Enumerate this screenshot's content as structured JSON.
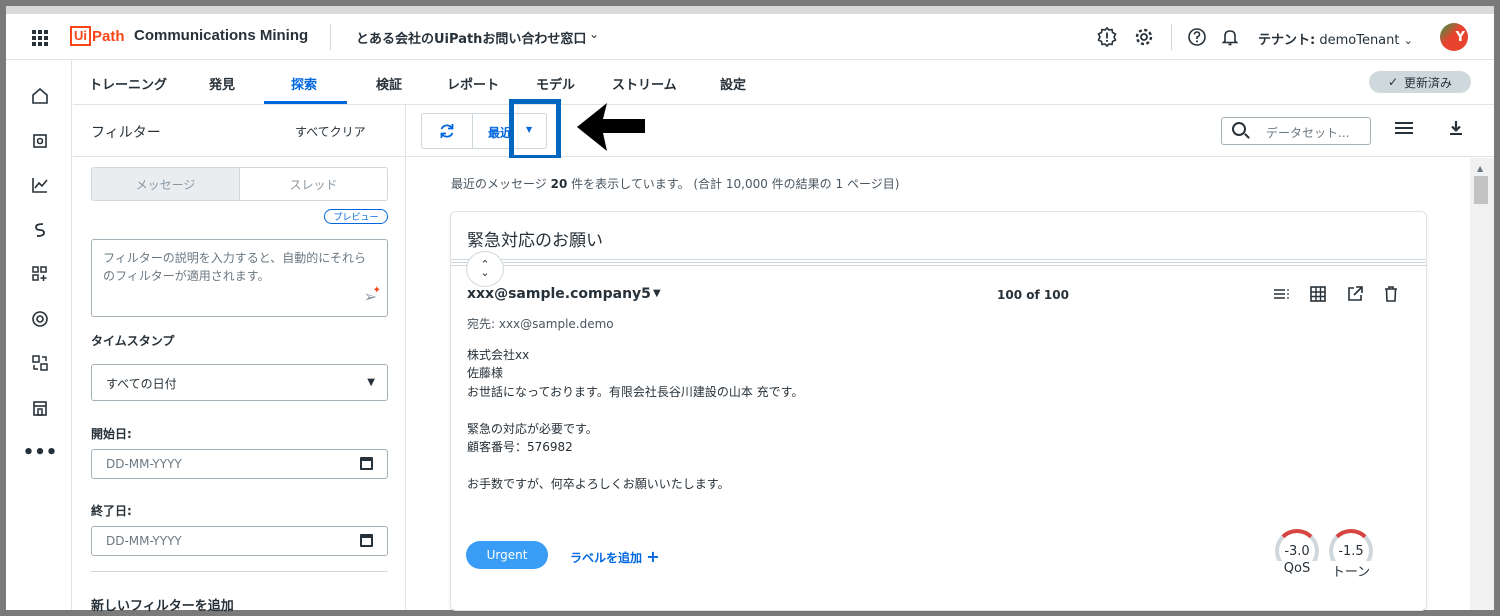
{
  "header": {
    "logo_ui": "Ui",
    "logo_path": "Path",
    "product": "Communications Mining",
    "project": "とある会社のUiPathお問い合わせ窓口",
    "project_caret": "⌄",
    "tenant_label": "テナント:",
    "tenant_value": "demoTenant",
    "tenant_caret": "⌄",
    "avatar_initial": "Y",
    "icons": [
      "apps-icon",
      "alert-icon",
      "gear-icon",
      "help-icon",
      "bell-icon"
    ]
  },
  "rail": {
    "icons": [
      "home-icon",
      "label-icon",
      "chart-icon",
      "flow-icon",
      "add-widget-icon",
      "stream-icon",
      "sync-icon",
      "store-icon",
      "more-icon"
    ]
  },
  "tabs": {
    "items": [
      "トレーニング",
      "発見",
      "探索",
      "検証",
      "レポート",
      "モデル",
      "ストリーム",
      "設定"
    ],
    "active": "探索",
    "status_badge": "更新済み"
  },
  "filter": {
    "title": "フィルター",
    "clear_all": "すべてクリア",
    "segments": [
      "メッセージ",
      "スレッド"
    ],
    "preview_pill": "プレビュー",
    "description_placeholder": "フィルターの説明を入力すると、自動的にそれらのフィルターが適用されます。",
    "timestamp_label": "タイムスタンプ",
    "timestamp_value": "すべての日付",
    "start_label": "開始日:",
    "start_placeholder": "DD-MM-YYYY",
    "end_label": "終了日:",
    "end_placeholder": "DD-MM-YYYY",
    "add_filter": "新しいフィルターを追加"
  },
  "toolbar": {
    "sort_label": "最近",
    "search_placeholder": "データセット..."
  },
  "content": {
    "summary_prefix": "最近のメッセージ",
    "summary_count": "20",
    "summary_suffix": "件を表示しています。 (合計 10,000 件の結果の 1 ページ目)",
    "card": {
      "title": "緊急対応のお願い",
      "sender": "xxx@sample.company5",
      "counter": "100 of 100",
      "to": "宛先: xxx@sample.demo",
      "body": "株式会社xx\n佐藤様\nお世話になっております。有限会社長谷川建設の山本 充です。\n\n緊急の対応が必要です。\n顧客番号：576982\n\nお手数ですが、何卒よろしくお願いいたします。",
      "label_pill": "Urgent",
      "add_label": "ラベルを追加",
      "gauges": [
        {
          "value": "-3.0",
          "label": "QoS"
        },
        {
          "value": "-1.5",
          "label": "トーン"
        }
      ]
    }
  },
  "colors": {
    "accent": "#0067df",
    "brand": "#fa4616",
    "highlight": "#0066c0",
    "urgent": "#3a9df5"
  }
}
